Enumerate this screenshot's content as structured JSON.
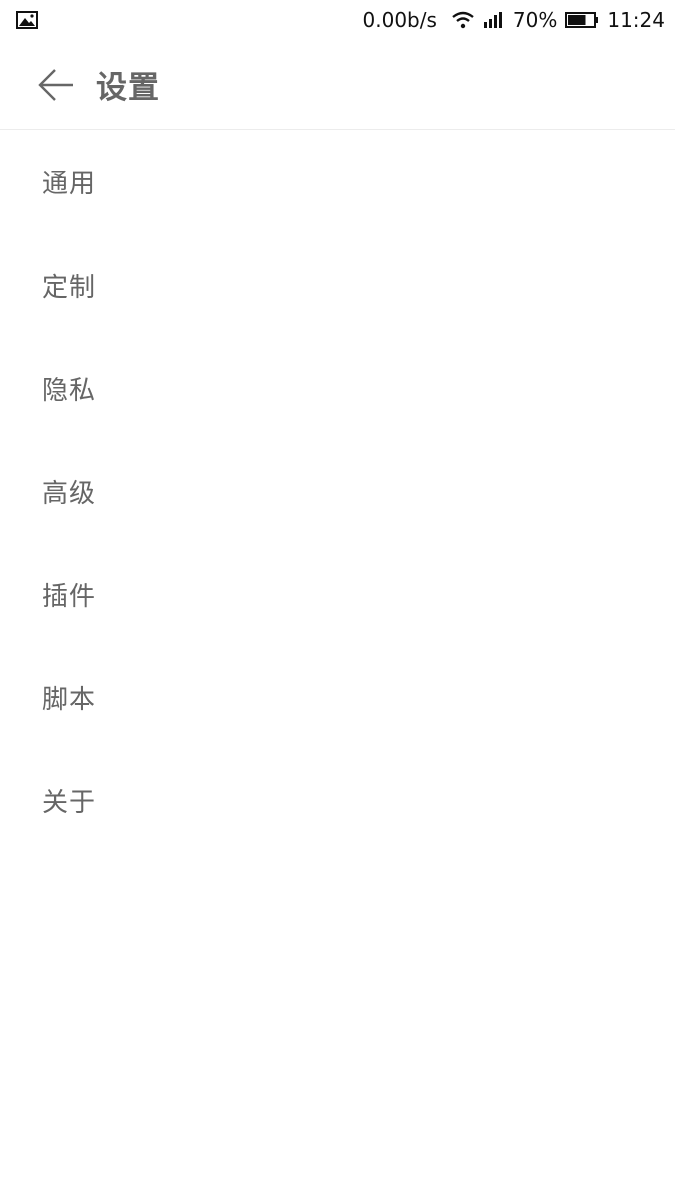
{
  "status_bar": {
    "notification_icon": "image-icon",
    "network_speed": "0.00b/s",
    "wifi_icon": "wifi-icon",
    "signal_icon": "signal-icon",
    "battery_percent": "70%",
    "battery_level": 0.7,
    "time": "11:24"
  },
  "header": {
    "back_icon": "arrow-left-icon",
    "title": "设置"
  },
  "menu": {
    "items": [
      {
        "label": "通用"
      },
      {
        "label": "定制"
      },
      {
        "label": "隐私"
      },
      {
        "label": "高级"
      },
      {
        "label": "插件"
      },
      {
        "label": "脚本"
      },
      {
        "label": "关于"
      }
    ]
  },
  "colors": {
    "text_gray": "#666666",
    "divider": "#ececec",
    "background": "#ffffff"
  }
}
